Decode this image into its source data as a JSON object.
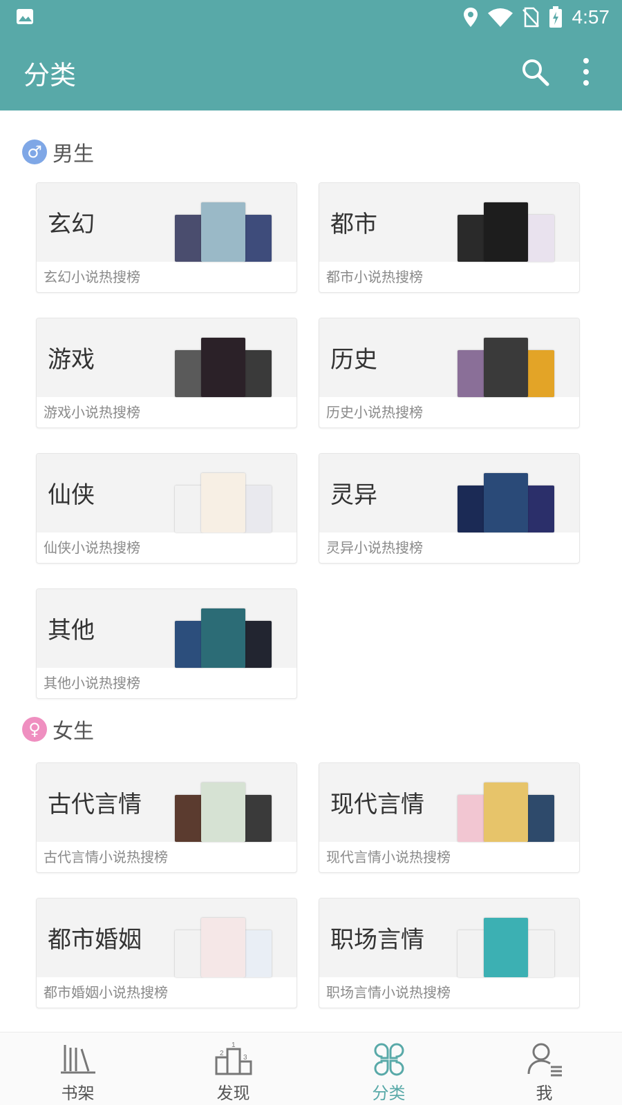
{
  "status_bar": {
    "time": "4:57"
  },
  "app_bar": {
    "title": "分类"
  },
  "colors": {
    "primary": "#58a9a8",
    "male": "#7fa7e6",
    "female": "#ef8fc0"
  },
  "sections": [
    {
      "label": "男生",
      "symbol": "♂",
      "cards": [
        {
          "name": "玄幻",
          "sub": "玄幻小说热搜榜",
          "covers": [
            "#4a4d6e",
            "#9ab9c7",
            "#3e4c7b"
          ]
        },
        {
          "name": "都市",
          "sub": "都市小说热搜榜",
          "covers": [
            "#2a2a2a",
            "#1d1d1d",
            "#e9e2ee"
          ]
        },
        {
          "name": "游戏",
          "sub": "游戏小说热搜榜",
          "covers": [
            "#5a5a5a",
            "#2b2128",
            "#3a3a3a"
          ]
        },
        {
          "name": "历史",
          "sub": "历史小说热搜榜",
          "covers": [
            "#8a6f98",
            "#3a3a3a",
            "#e3a427"
          ]
        },
        {
          "name": "仙侠",
          "sub": "仙侠小说热搜榜",
          "covers": [
            "#f2f2f2",
            "#f7efe4",
            "#e9e9ee"
          ]
        },
        {
          "name": "灵异",
          "sub": "灵异小说热搜榜",
          "covers": [
            "#1b2a55",
            "#2a4a78",
            "#2b2f6a"
          ]
        },
        {
          "name": "其他",
          "sub": "其他小说热搜榜",
          "covers": [
            "#2c4e7c",
            "#2c6c76",
            "#222530"
          ]
        }
      ]
    },
    {
      "label": "女生",
      "symbol": "♀",
      "cards": [
        {
          "name": "古代言情",
          "sub": "古代言情小说热搜榜",
          "covers": [
            "#5b3b2f",
            "#d6e2d3",
            "#3a3a3a"
          ]
        },
        {
          "name": "现代言情",
          "sub": "现代言情小说热搜榜",
          "covers": [
            "#f2c6d2",
            "#e7c46a",
            "#2e4a6b"
          ]
        },
        {
          "name": "都市婚姻",
          "sub": "都市婚姻小说热搜榜",
          "covers": [
            "#f2f2f2",
            "#f5e7e7",
            "#e9eef5"
          ]
        },
        {
          "name": "职场言情",
          "sub": "职场言情小说热搜榜",
          "covers": [
            "#f2f2f2",
            "#3cb0b3",
            "#f2f2f2"
          ]
        }
      ]
    }
  ],
  "bottom_nav": [
    {
      "label": "书架",
      "icon": "bookshelf-icon",
      "active": false
    },
    {
      "label": "发现",
      "icon": "podium-icon",
      "active": false
    },
    {
      "label": "分类",
      "icon": "category-icon",
      "active": true
    },
    {
      "label": "我",
      "icon": "user-icon",
      "active": false
    }
  ]
}
